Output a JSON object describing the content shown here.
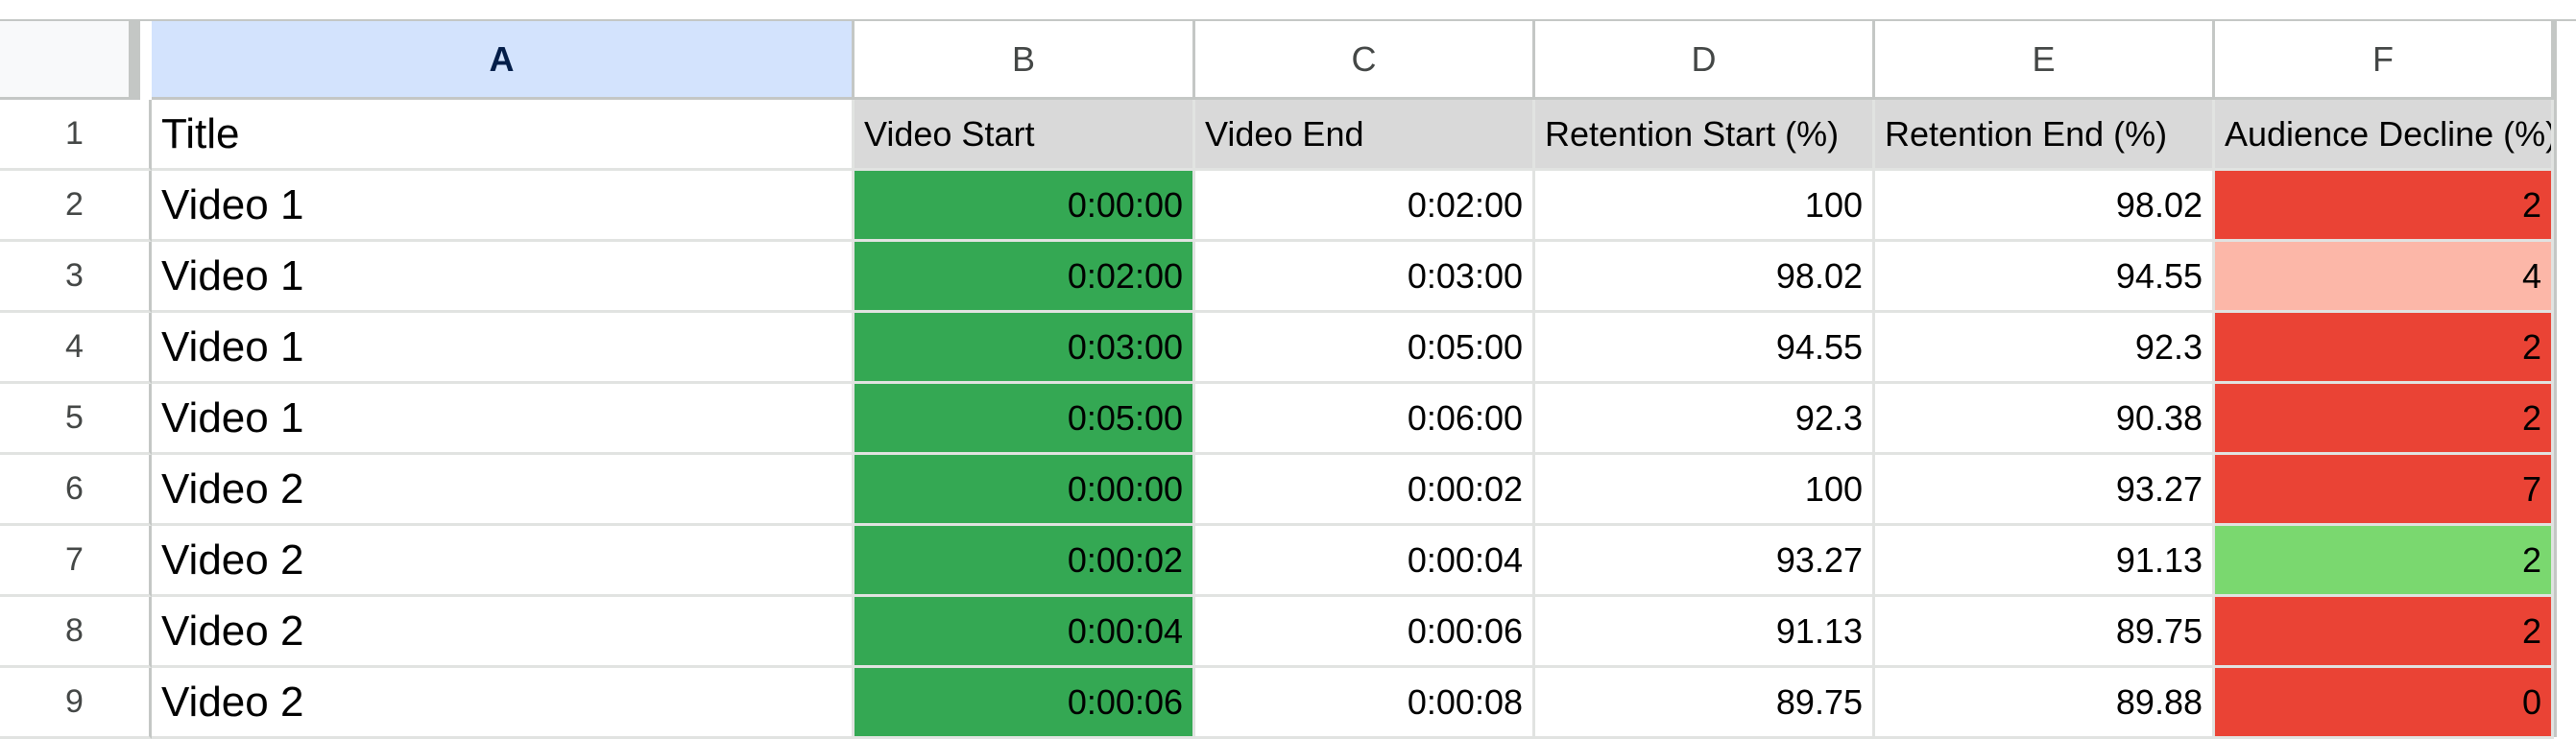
{
  "columns": [
    "A",
    "B",
    "C",
    "D",
    "E",
    "F"
  ],
  "row_numbers": [
    "1",
    "2",
    "3",
    "4",
    "5",
    "6",
    "7",
    "8",
    "9"
  ],
  "header": {
    "title": "Title",
    "video_start": "Video Start",
    "video_end": "Video End",
    "retention_start": "Retention Start (%)",
    "retention_end": "Retention End (%)",
    "audience_decline": "Audience Decline (%)"
  },
  "rows": [
    {
      "title": "Video 1",
      "start": "0:00:00",
      "end": "0:02:00",
      "ret_start": "100",
      "ret_end": "98.02",
      "decline": "2",
      "decline_color": "#ea4335"
    },
    {
      "title": "Video 1",
      "start": "0:02:00",
      "end": "0:03:00",
      "ret_start": "98.02",
      "ret_end": "94.55",
      "decline": "4",
      "decline_color": "#fcb7a8"
    },
    {
      "title": "Video 1",
      "start": "0:03:00",
      "end": "0:05:00",
      "ret_start": "94.55",
      "ret_end": "92.3",
      "decline": "2",
      "decline_color": "#ea4335"
    },
    {
      "title": "Video 1",
      "start": "0:05:00",
      "end": "0:06:00",
      "ret_start": "92.3",
      "ret_end": "90.38",
      "decline": "2",
      "decline_color": "#ea4335"
    },
    {
      "title": "Video 2",
      "start": "0:00:00",
      "end": "0:00:02",
      "ret_start": "100",
      "ret_end": "93.27",
      "decline": "7",
      "decline_color": "#ea4335"
    },
    {
      "title": "Video 2",
      "start": "0:00:02",
      "end": "0:00:04",
      "ret_start": "93.27",
      "ret_end": "91.13",
      "decline": "2",
      "decline_color": "#7ad86f"
    },
    {
      "title": "Video 2",
      "start": "0:00:04",
      "end": "0:00:06",
      "ret_start": "91.13",
      "ret_end": "89.75",
      "decline": "2",
      "decline_color": "#ea4335"
    },
    {
      "title": "Video 2",
      "start": "0:00:06",
      "end": "0:00:08",
      "ret_start": "89.75",
      "ret_end": "89.88",
      "decline": "0",
      "decline_color": "#ea4335"
    }
  ],
  "colors": {
    "start_fill": "#34a853",
    "header_fill": "#d9d9d9",
    "selected_column": "#d3e3fd"
  }
}
